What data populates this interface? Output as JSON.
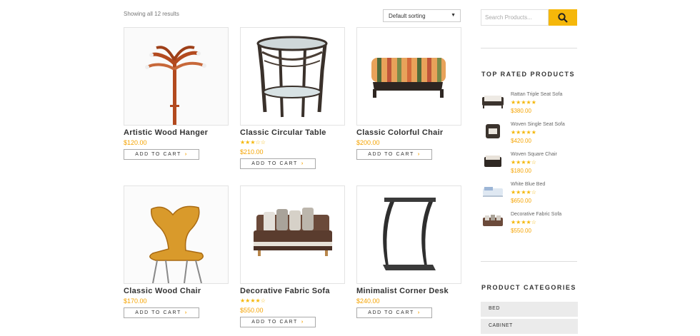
{
  "shop": {
    "result_count": "Showing all 12 results",
    "sort_label": "Default sorting",
    "add_to_cart": "ADD TO CART",
    "products": [
      {
        "name": "Artistic Wood Hanger",
        "price": "$120.00",
        "stars": ""
      },
      {
        "name": "Classic Circular Table",
        "price": "$210.00",
        "stars": "★★★☆☆"
      },
      {
        "name": "Classic Colorful Chair",
        "price": "$200.00",
        "stars": ""
      },
      {
        "name": "Classic Wood Chair",
        "price": "$170.00",
        "stars": ""
      },
      {
        "name": "Decorative Fabric Sofa",
        "price": "$550.00",
        "stars": "★★★★☆"
      },
      {
        "name": "Minimalist Corner Desk",
        "price": "$240.00",
        "stars": ""
      }
    ]
  },
  "sidebar": {
    "search_placeholder": "Search Products...",
    "top_rated_title": "TOP RATED PRODUCTS",
    "top_rated": [
      {
        "name": "Rattan Triple Seat Sofa",
        "stars": "★★★★★",
        "price": "$380.00"
      },
      {
        "name": "Woven Single Seat Sofa",
        "stars": "★★★★★",
        "price": "$420.00"
      },
      {
        "name": "Woven Square Chair",
        "stars": "★★★★☆",
        "price": "$180.00"
      },
      {
        "name": "White Blue Bed",
        "stars": "★★★★☆",
        "price": "$650.00"
      },
      {
        "name": "Decorative Fabric Sofa",
        "stars": "★★★★☆",
        "price": "$550.00"
      }
    ],
    "categories_title": "PRODUCT CATEGORIES",
    "categories": [
      "BED",
      "CABINET"
    ]
  },
  "colors": {
    "accent": "#f5b70a",
    "price": "#f5a300"
  }
}
